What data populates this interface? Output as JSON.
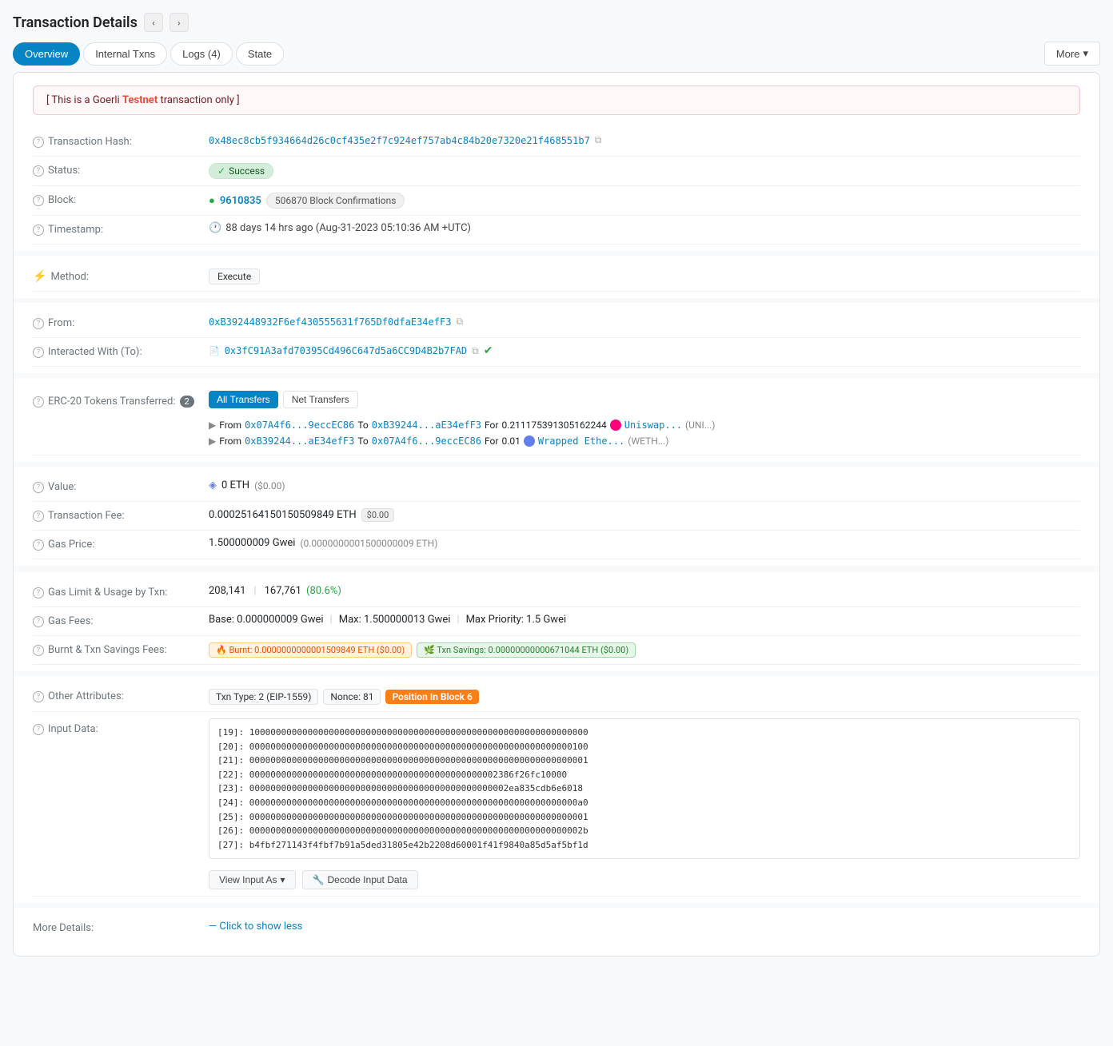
{
  "page": {
    "title": "Transaction Details"
  },
  "tabs": {
    "items": [
      {
        "label": "Overview",
        "active": true
      },
      {
        "label": "Internal Txns",
        "active": false
      },
      {
        "label": "Logs (4)",
        "active": false
      },
      {
        "label": "State",
        "active": false
      }
    ],
    "more_label": "More"
  },
  "alert": {
    "prefix": "[ This is a Goerli",
    "testnet": "Testnet",
    "suffix": "transaction only ]"
  },
  "fields": {
    "transaction_hash": {
      "label": "Transaction Hash:",
      "value": "0x48ec8cb5f934664d26c0cf435e2f7c924ef757ab4c84b20e7320e21f468551b7"
    },
    "status": {
      "label": "Status:",
      "value": "Success"
    },
    "block": {
      "label": "Block:",
      "number": "9610835",
      "confirmations": "506870 Block Confirmations"
    },
    "timestamp": {
      "label": "Timestamp:",
      "value": "88 days 14 hrs ago (Aug-31-2023 05:10:36 AM +UTC)"
    },
    "method": {
      "label": "Method:",
      "value": "Execute"
    },
    "from": {
      "label": "From:",
      "value": "0xB392448932F6ef430555631f765Df0dfaE34efF3"
    },
    "interacted_with": {
      "label": "Interacted With (To):",
      "value": "0x3fC91A3afd70395Cd496C647d5a6CC9D4B2b7FAD"
    },
    "erc20": {
      "label": "ERC-20 Tokens Transferred:",
      "count": "2",
      "transfers": [
        {
          "from": "0x07A4f6...9eccEC86",
          "to": "0xB39244...aE34efF3",
          "amount": "0.211175391305162244",
          "token_name": "Uniswap...",
          "token_symbol": "UNI..."
        },
        {
          "from": "0xB39244...aE34efF3",
          "to": "0x07A4f6...9eccEC86",
          "amount": "0.01",
          "token_name": "Wrapped Ethe...",
          "token_symbol": "WETH..."
        }
      ]
    },
    "value": {
      "label": "Value:",
      "eth": "0 ETH",
      "usd": "($0.00)"
    },
    "transaction_fee": {
      "label": "Transaction Fee:",
      "eth": "0.00025164150150509849 ETH",
      "usd": "$0.00"
    },
    "gas_price": {
      "label": "Gas Price:",
      "gwei": "1.500000009 Gwei",
      "eth": "(0.0000000001500000009 ETH)"
    },
    "gas_limit_usage": {
      "label": "Gas Limit & Usage by Txn:",
      "limit": "208,141",
      "used": "167,761",
      "percent": "80.6%"
    },
    "gas_fees": {
      "label": "Gas Fees:",
      "base": "Base: 0.000000009 Gwei",
      "max": "Max: 1.500000013 Gwei",
      "max_priority": "Max Priority: 1.5 Gwei"
    },
    "burnt_savings": {
      "label": "Burnt & Txn Savings Fees:",
      "burnt": "Burnt: 0.0000000000001509849 ETH ($0.00)",
      "savings": "Txn Savings: 0.00000000000671044 ETH ($0.00)"
    },
    "other_attributes": {
      "label": "Other Attributes:",
      "txn_type": "Txn Type: 2 (EIP-1559)",
      "nonce": "Nonce: 81",
      "position": "Position In Block",
      "position_value": "6"
    },
    "input_data": {
      "label": "Input Data:",
      "lines": [
        "[19]: 1000000000000000000000000000000000000000000000000000000000000000",
        "[20]: 0000000000000000000000000000000000000000000000000000000000000100",
        "[21]: 0000000000000000000000000000000000000000000000000000000000000001",
        "[22]: 00000000000000000000000000000000000000000000002386f26fc10000",
        "[23]: 0000000000000000000000000000000000000000000000002ea835cdb6e6018",
        "[24]: 00000000000000000000000000000000000000000000000000000000000000a0",
        "[25]: 0000000000000000000000000000000000000000000000000000000000000001",
        "[26]: 000000000000000000000000000000000000000000000000000000000000002b",
        "[27]: b4fbf271143f4fbf7b91a5ded31805e42b2208d60001f41f9840a85d5af5bf1d"
      ],
      "view_as_label": "View Input As",
      "decode_label": "Decode Input Data"
    },
    "more_details": {
      "label": "More Details:",
      "link": "Click to show less"
    }
  }
}
